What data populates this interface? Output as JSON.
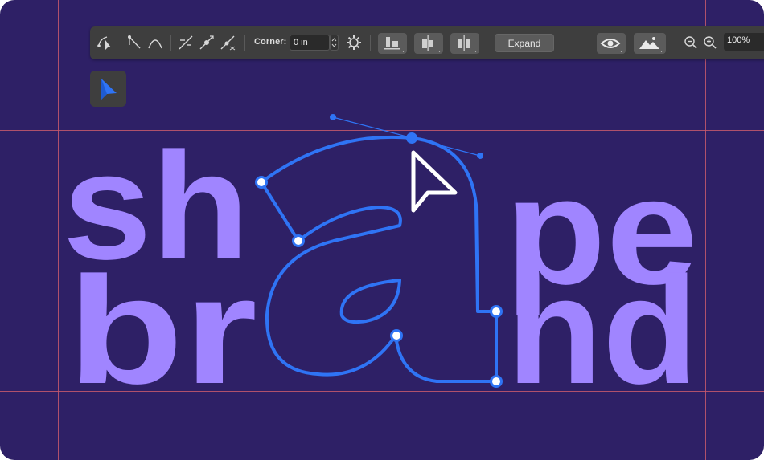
{
  "toolbar": {
    "corner_label": "Corner:",
    "corner_value": "0 in",
    "expand_label": "Expand",
    "zoom_value": "100%"
  },
  "artwork": {
    "line1": "sh",
    "line1b": "pe",
    "line2": "br",
    "line2b": "nd",
    "letter_colour": "#a085ff",
    "path_colour": "#2f74f5",
    "background_colour": "#2e2066",
    "guide_colour": "#c75a6c"
  },
  "icons": [
    "path-select-icon",
    "pen-icon",
    "curve-icon",
    "cut-path-icon",
    "join-anchor-icon",
    "remove-anchor-icon",
    "gear-icon",
    "align-bottom-icon",
    "align-center-icon",
    "distribute-icon",
    "eye-icon",
    "image-icon",
    "zoom-out-icon",
    "zoom-in-icon",
    "direct-select-arrow-icon"
  ]
}
